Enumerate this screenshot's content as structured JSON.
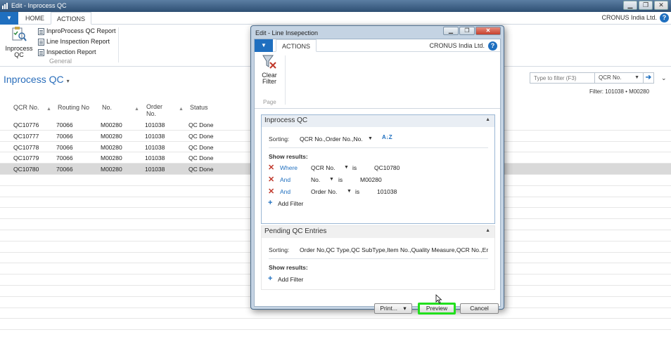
{
  "window": {
    "title": "Edit - Inprocess QC",
    "minimize": "▁",
    "restore": "❐",
    "close": "✕"
  },
  "ribbon": {
    "file_label": "▼",
    "tabs": [
      "HOME",
      "ACTIONS"
    ],
    "company": "CRONUS India Ltd.",
    "help": "?",
    "big_button": "Inprocess QC",
    "small_buttons": [
      "InproProcess QC Report",
      "Line Inspection Report",
      "Inspection Report"
    ],
    "group_label": "General"
  },
  "page": {
    "title": "Inprocess QC",
    "title_caret": "▾",
    "filter_placeholder": "Type to filter (F3)",
    "filter_field": "QCR No.",
    "filter_go": "➔",
    "expand": "⌄",
    "filter_summary": "Filter: 101038 • M00280"
  },
  "table": {
    "columns": [
      "QCR No.",
      "Routing No",
      "No.",
      "Order No.",
      "Status"
    ],
    "rows": [
      [
        "QC10776",
        "70066",
        "M00280",
        "101038",
        "QC Done"
      ],
      [
        "QC10777",
        "70066",
        "M00280",
        "101038",
        "QC Done"
      ],
      [
        "QC10778",
        "70066",
        "M00280",
        "101038",
        "QC Done"
      ],
      [
        "QC10779",
        "70066",
        "M00280",
        "101038",
        "QC Done"
      ],
      [
        "QC10780",
        "70066",
        "M00280",
        "101038",
        "QC Done"
      ]
    ],
    "selected_row": 4
  },
  "dialog": {
    "title": "Edit - Line Insepection",
    "minimize": "▁",
    "restore": "❐",
    "close": "✕",
    "file_label": "▼",
    "tab": "ACTIONS",
    "company": "CRONUS India Ltd.",
    "help": "?",
    "clear_filter": "Clear Filter",
    "group_label": "Page",
    "section1": {
      "title": "Inprocess QC",
      "collapse": "▲",
      "sorting_label": "Sorting:",
      "sorting_value": "QCR No.,Order No.,No.",
      "sort_order_icon": "A↓Z",
      "show_results": "Show results:",
      "filters": [
        {
          "conj": "Where",
          "field": "QCR No.",
          "op": "is",
          "value": "QC10780"
        },
        {
          "conj": "And",
          "field": "No.",
          "op": "is",
          "value": "M00280"
        },
        {
          "conj": "And",
          "field": "Order No.",
          "op": "is",
          "value": "101038"
        }
      ],
      "add_filter": "Add Filter"
    },
    "section2": {
      "title": "Pending QC Entries",
      "collapse": "▲",
      "sorting_label": "Sorting:",
      "sorting_value": "Order No,QC Type,QC SubType,Item No.,Quality Measure,QCR No.,Er",
      "show_results": "Show results:",
      "add_filter": "Add Filter"
    },
    "buttons": {
      "print": "Print...",
      "print_caret": "▾",
      "preview": "Preview",
      "cancel": "Cancel"
    },
    "highlight_color": "#22e01e"
  },
  "colors": {
    "accent": "#1f6fbf",
    "title_text": "#2a6ebb",
    "selected_row": "#d9d9d9",
    "remove_filter": "#c0392b"
  }
}
